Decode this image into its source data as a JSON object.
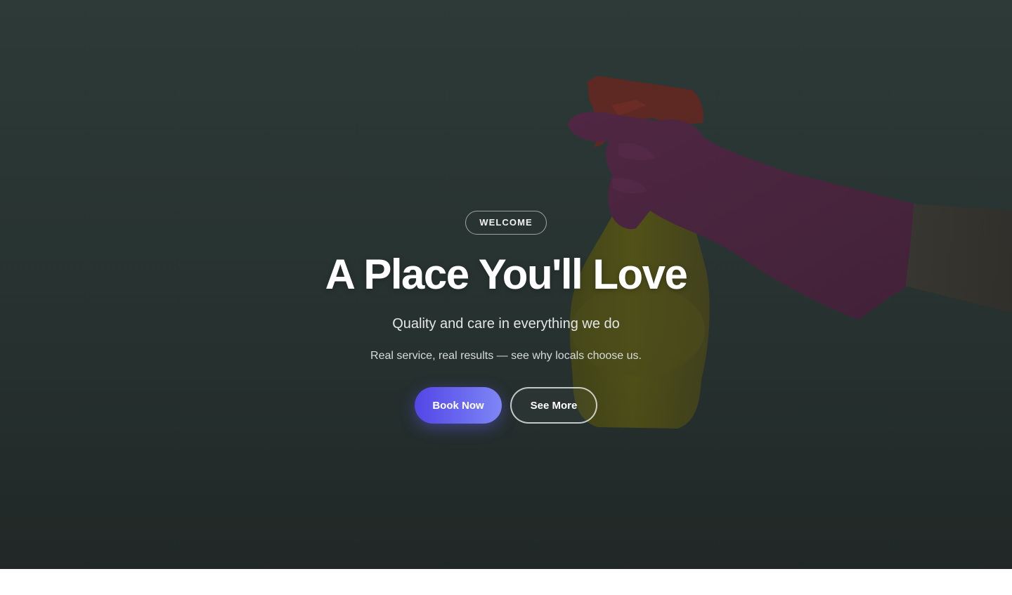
{
  "hero": {
    "eyebrow": "WELCOME",
    "title": "A Place You'll Love",
    "subtitle": "Quality and care in everything we do",
    "tagline": "Real service, real results — see why locals choose us.",
    "primary_cta": "Book Now",
    "secondary_cta": "See More",
    "background_image": "gloved-hand-spray-bottle",
    "colors": {
      "accent_start": "#5346e6",
      "accent_end": "#7f86f5",
      "overlay": "#2b3735"
    }
  }
}
